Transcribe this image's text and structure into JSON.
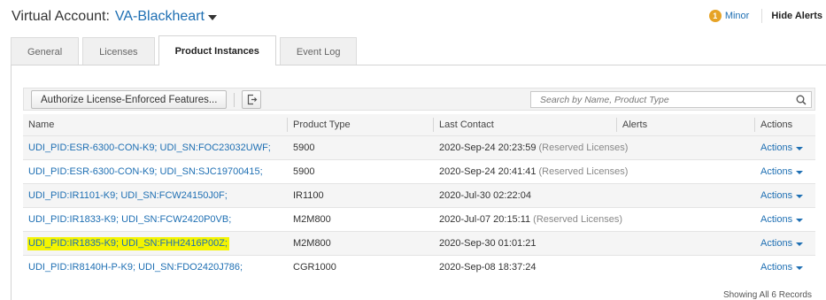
{
  "header": {
    "label": "Virtual Account:",
    "account_name": "VA-Blackheart"
  },
  "alerts": {
    "count": "1",
    "level": "Minor",
    "hide_label": "Hide Alerts"
  },
  "tabs": [
    {
      "label": "General",
      "active": false
    },
    {
      "label": "Licenses",
      "active": false
    },
    {
      "label": "Product Instances",
      "active": true
    },
    {
      "label": "Event Log",
      "active": false
    }
  ],
  "toolbar": {
    "authorize_label": "Authorize License-Enforced Features...",
    "export_icon": "export-icon",
    "search_placeholder": "Search by Name, Product Type"
  },
  "table": {
    "columns": [
      "Name",
      "Product Type",
      "Last Contact",
      "Alerts",
      "Actions"
    ],
    "rows": [
      {
        "name": "UDI_PID:ESR-6300-CON-K9; UDI_SN:FOC23032UWF;",
        "type": "5900",
        "contact": "2020-Sep-24 20:23:59",
        "reserved": "(Reserved Licenses)",
        "alerts": "",
        "actions": "Actions",
        "highlighted": false
      },
      {
        "name": "UDI_PID:ESR-6300-CON-K9; UDI_SN:SJC19700415;",
        "type": "5900",
        "contact": "2020-Sep-24 20:41:41",
        "reserved": "(Reserved Licenses)",
        "alerts": "",
        "actions": "Actions",
        "highlighted": false
      },
      {
        "name": "UDI_PID:IR1101-K9; UDI_SN:FCW24150J0F;",
        "type": "IR1100",
        "contact": "2020-Jul-30 02:22:04",
        "reserved": "",
        "alerts": "",
        "actions": "Actions",
        "highlighted": false
      },
      {
        "name": "UDI_PID:IR1833-K9; UDI_SN:FCW2420P0VB;",
        "type": "M2M800",
        "contact": "2020-Jul-07 20:15:11",
        "reserved": "(Reserved Licenses)",
        "alerts": "",
        "actions": "Actions",
        "highlighted": false
      },
      {
        "name": "UDI_PID:IR1835-K9; UDI_SN:FHH2416P00Z;",
        "type": "M2M800",
        "contact": "2020-Sep-30 01:01:21",
        "reserved": "",
        "alerts": "",
        "actions": "Actions",
        "highlighted": true
      },
      {
        "name": "UDI_PID:IR8140H-P-K9; UDI_SN:FDO2420J786;",
        "type": "CGR1000",
        "contact": "2020-Sep-08 18:37:24",
        "reserved": "",
        "alerts": "",
        "actions": "Actions",
        "highlighted": false
      }
    ]
  },
  "footer": {
    "records_text": "Showing All 6 Records"
  },
  "colors": {
    "link": "#1e6fb3",
    "highlight": "#f4f400",
    "badge": "#e6a326"
  }
}
